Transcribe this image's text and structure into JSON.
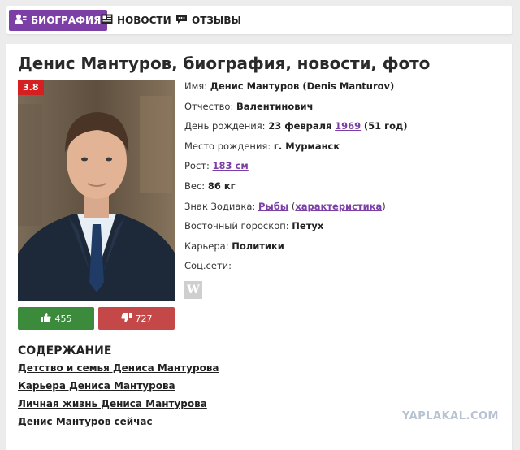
{
  "tabs": [
    {
      "label": "БИОГРАФИЯ",
      "icon": "user-icon",
      "active": true
    },
    {
      "label": "НОВОСТИ",
      "icon": "newspaper-icon",
      "active": false
    },
    {
      "label": "ОТЗЫВЫ",
      "icon": "comment-icon",
      "active": false
    }
  ],
  "title": "Денис Мантуров, биография, новости, фото",
  "rating": "3.8",
  "votes": {
    "up": "455",
    "down": "727"
  },
  "info": {
    "name_label": "Имя:",
    "name_value": "Денис Мантуров (Denis Manturov)",
    "patronymic_label": "Отчество:",
    "patronymic_value": "Валентинович",
    "birthday_label": "День рождения:",
    "birthday_day": "23 февраля",
    "birthday_year": "1969",
    "birthday_age": "(51 год)",
    "birthplace_label": "Место рождения:",
    "birthplace_value": "г. Мурманск",
    "height_label": "Рост:",
    "height_value": "183 см",
    "weight_label": "Вес:",
    "weight_value": "86 кг",
    "zodiac_label": "Знак Зодиака:",
    "zodiac_value": "Рыбы",
    "zodiac_open": "(",
    "zodiac_link": "характеристика",
    "zodiac_close": ")",
    "eastern_label": "Восточный гороскоп:",
    "eastern_value": "Петух",
    "career_label": "Карьера:",
    "career_value": "Политики",
    "social_label": "Соц.сети:",
    "wiki_glyph": "W"
  },
  "toc": {
    "title": "СОДЕРЖАНИЕ",
    "items": [
      "Детство и семья Дениса Мантурова",
      "Карьера Дениса Мантурова",
      "Личная жизнь Дениса Мантурова",
      "Денис Мантуров сейчас"
    ]
  },
  "watermark": "YAPLAKAL.COM",
  "colors": {
    "accent": "#7b3fa6",
    "rating": "#d42020",
    "like": "#3c8a3c",
    "dislike": "#c44848"
  }
}
